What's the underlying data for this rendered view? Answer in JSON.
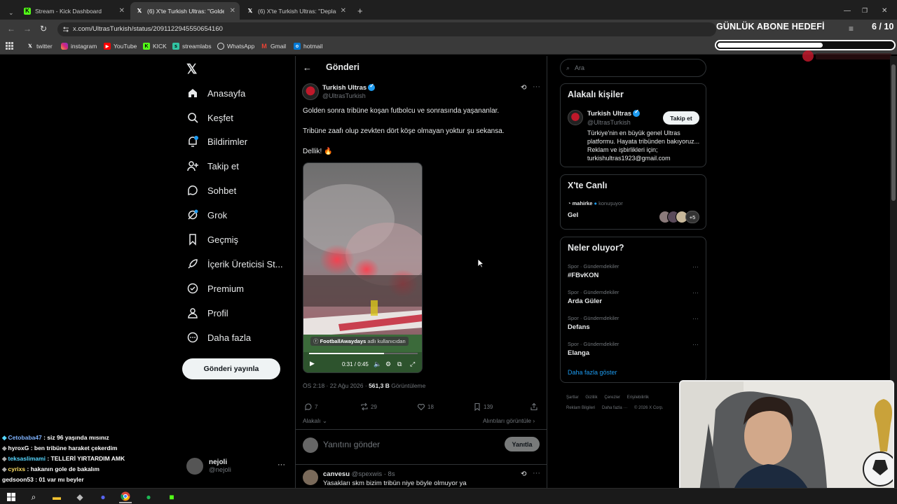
{
  "browser": {
    "tabs": [
      {
        "title": "Stream - Kick Dashboard",
        "icon": "kick-icon"
      },
      {
        "title": "(6) X'te Turkish Ultras: \"Golden",
        "icon": "x-icon"
      },
      {
        "title": "(6) X'te Turkish Ultras: \"Deplasm",
        "icon": "x-icon"
      }
    ],
    "url": "x.com/UltrasTurkish/status/2091122945550654160",
    "bookmarks": [
      "twitter",
      "instagram",
      "YouTube",
      "KICK",
      "streamlabs",
      "WhatsApp",
      "Gmail",
      "hotmail"
    ]
  },
  "overlay": {
    "goal_title": "GÜNLÜK ABONE HEDEFİ",
    "goal_count": "6 / 10",
    "goal_progress": 0.6
  },
  "sidebar": {
    "items": [
      {
        "label": "Anasayfa",
        "icon": "home-icon"
      },
      {
        "label": "Keşfet",
        "icon": "search-icon"
      },
      {
        "label": "Bildirimler",
        "icon": "bell-icon"
      },
      {
        "label": "Takip et",
        "icon": "add-user-icon"
      },
      {
        "label": "Sohbet",
        "icon": "chat-icon"
      },
      {
        "label": "Grok",
        "icon": "grok-icon"
      },
      {
        "label": "Geçmiş",
        "icon": "bookmark-icon"
      },
      {
        "label": "İçerik Üreticisi St...",
        "icon": "rocket-icon"
      },
      {
        "label": "Premium",
        "icon": "verified-icon"
      },
      {
        "label": "Profil",
        "icon": "profile-icon"
      },
      {
        "label": "Daha fazla",
        "icon": "more-circle-icon"
      }
    ],
    "post_button": "Gönderi yayınla",
    "user_name": "nejoli",
    "user_handle": "@nejoli"
  },
  "main": {
    "title": "Gönderi",
    "post": {
      "author": "Turkish Ultras",
      "handle": "@UltrasTurkish",
      "lines": [
        "Golden sonra tribüne koşan futbolcu ve sonrasında yaşananlar.",
        "Tribüne zaafı olup zevkten dört köşe olmayan yoktur şu sekansa.",
        "Dellik! 🔥"
      ],
      "video_caption_user": "FootballAwaydays",
      "video_caption_suffix": "adlı kullanıcıdan",
      "video_time": "0:31 / 0:45",
      "time": "ÖS 2:18 · 22 Ağu 2026 ·",
      "views": "561,3 B",
      "views_label": "Görüntüleme",
      "replies": "7",
      "reposts": "29",
      "likes": "18",
      "bookmarks": "139",
      "related": "Alakalı",
      "quotes": "Alıntıları görüntüle"
    },
    "reply_placeholder": "Yanıtını gönder",
    "reply_button": "Yanıtla",
    "comment": {
      "name": "canvesu",
      "meta": "@spexwis · 8s",
      "text": "Yasakları skm bizim tribün niye böyle olmuyor ya"
    }
  },
  "right": {
    "search_placeholder": "Ara",
    "related_title": "Alakalı kişiler",
    "related_person": {
      "name": "Turkish Ultras",
      "handle": "@UltrasTurkish",
      "follow": "Takip et",
      "bio": "Türkiye'nin en büyük genel Ultras platformu. Hayata tribünden bakıyoruz... Reklam ve işbirlikleri için; turkishultras1923@gmail.com"
    },
    "live_title": "X'te Canlı",
    "live_user": "mahirke",
    "live_status": "konuşuyor",
    "live_text": "Gel",
    "live_more": "+5",
    "trends_title": "Neler oluyor?",
    "trends": [
      {
        "category": "Spor · Gündemdekiler",
        "title": "#FBvKON"
      },
      {
        "category": "Spor · Gündemdekiler",
        "title": "Arda Güler"
      },
      {
        "category": "Spor · Gündemdekiler",
        "title": "Defans"
      },
      {
        "category": "Spor · Gündemdekiler",
        "title": "Elanga"
      }
    ],
    "show_more": "Daha fazla göster",
    "footer": [
      "Şartlar",
      "Gizlilik",
      "Çerezler",
      "Erişilebilirlik",
      "Reklam Bilgileri",
      "Daha fazla ···",
      "© 2026 X Corp."
    ]
  },
  "chat": [
    {
      "user": "Cetobaba47",
      "msg": ": siz 96 yaşında mısınız",
      "color": "#7fb3ff"
    },
    {
      "user": "hyroxG",
      "msg": ": ben tribüne haraket çekerdim",
      "color": "#ffffff"
    },
    {
      "user": "teksaslimami",
      "msg": ": TELLERİ YIRTARDIM AMK",
      "color": "#56d6ff"
    },
    {
      "user": "cyrixs",
      "msg": ": hakanın gole de bakalım",
      "color": "#ffe066"
    },
    {
      "user": "gedsoon53",
      "msg": ": 01 var mı beyler",
      "color": "#ffffff"
    }
  ]
}
